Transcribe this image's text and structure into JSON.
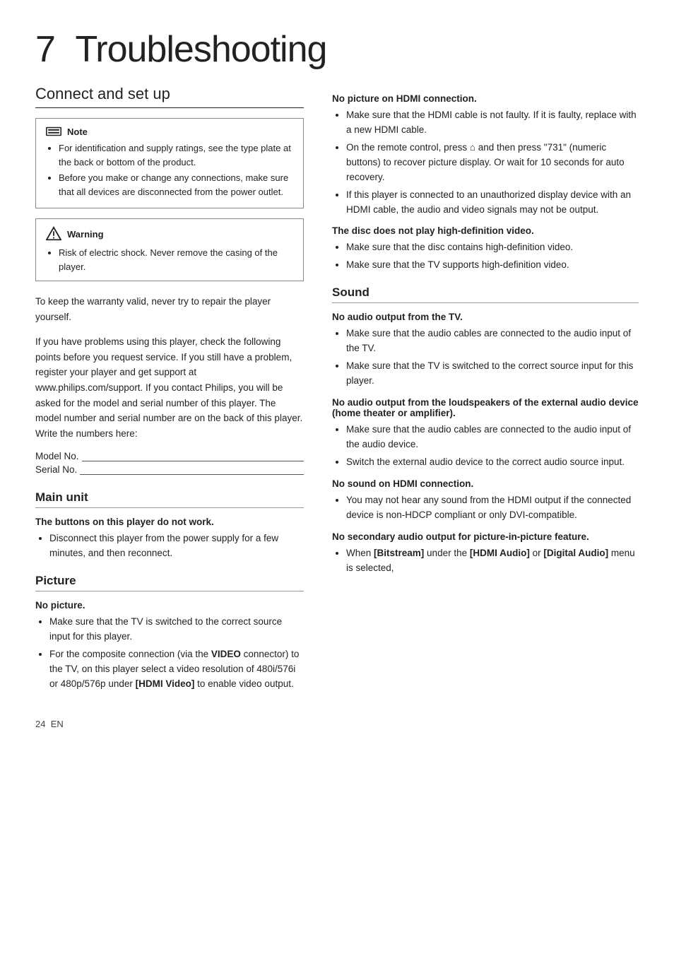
{
  "page": {
    "chapter_number": "7",
    "chapter_title": "Troubleshooting",
    "footer": {
      "page_number": "24",
      "language": "EN"
    }
  },
  "left": {
    "connect_setup": {
      "title": "Connect and set up",
      "note": {
        "label": "Note",
        "items": [
          "For identification and supply ratings, see the type plate at the back or bottom of the product.",
          "Before you make or change any connections, make sure that all devices are disconnected from the power outlet."
        ]
      },
      "warning": {
        "label": "Warning",
        "items": [
          "Risk of electric shock. Never remove the casing of the player."
        ]
      },
      "body1": "To keep the warranty valid, never try to repair the player yourself.",
      "body2": "If you have problems using this player, check the following points before you request service. If you still have a problem, register your player and get support at www.philips.com/support. If you contact Philips, you will be asked for the model and serial number of this player. The model number and serial number are on the back of this player. Write the numbers here:",
      "model_label": "Model No.",
      "serial_label": "Serial No."
    },
    "main_unit": {
      "title": "Main unit",
      "problem1_title": "The buttons on this player do not work.",
      "problem1_items": [
        "Disconnect this player from the power supply for a few minutes, and then reconnect."
      ]
    },
    "picture": {
      "title": "Picture",
      "no_picture_title": "No picture.",
      "no_picture_items": [
        "Make sure that the TV is switched to the correct source input for this player.",
        "For the composite connection (via the VIDEO connector) to the TV, on this player select a video resolution of 480i/576i or 480p/576p under [HDMI Video] to enable video output."
      ]
    }
  },
  "right": {
    "picture_continued": {
      "no_hdmi_title": "No picture on HDMI connection.",
      "no_hdmi_items": [
        "Make sure that the HDMI cable is not faulty. If it is faulty, replace with a new HDMI cable.",
        "On the remote control, press ⌂ and then press \"731\" (numeric buttons) to recover picture display. Or wait for 10 seconds for auto recovery.",
        "If this player is connected to an unauthorized display device with an HDMI cable, the audio and video signals may not be output."
      ],
      "no_hd_title": "The disc does not play high-definition video.",
      "no_hd_items": [
        "Make sure that the disc contains high-definition video.",
        "Make sure that the TV supports high-definition video."
      ]
    },
    "sound": {
      "title": "Sound",
      "no_audio_tv_title": "No audio output from the TV.",
      "no_audio_tv_items": [
        "Make sure that the audio cables are connected to the audio input of the TV.",
        "Make sure that the TV is switched to the correct source input for this player."
      ],
      "no_audio_ext_title": "No audio output from the loudspeakers of the external audio device (home theater or amplifier).",
      "no_audio_ext_items": [
        "Make sure that the audio cables are connected to the audio input of the audio device.",
        "Switch the external audio device to the correct audio source input."
      ],
      "no_sound_hdmi_title": "No sound on HDMI connection.",
      "no_sound_hdmi_items": [
        "You may not hear any sound from the HDMI output if the connected device is non-HDCP compliant or only DVI-compatible."
      ],
      "no_secondary_title": "No secondary audio output for picture-in-picture feature.",
      "no_secondary_items": [
        "When [Bitstream] under the [HDMI Audio] or [Digital Audio] menu is selected,"
      ]
    }
  }
}
